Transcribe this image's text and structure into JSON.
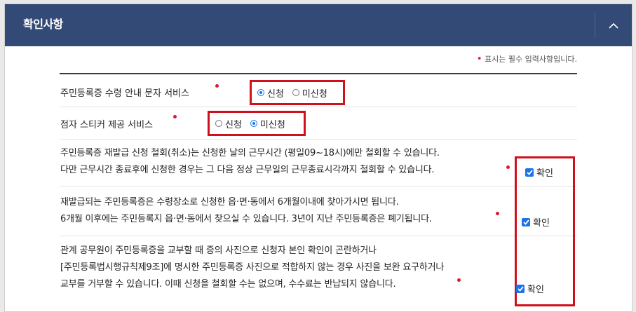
{
  "header": {
    "title": "확인사항"
  },
  "required_note": "표시는 필수 입력사항입니다.",
  "services": [
    {
      "label": "주민등록증 수령 안내 문자 서비스",
      "options": [
        "신청",
        "미신청"
      ],
      "selected": "신청"
    },
    {
      "label": "점자 스티커 제공 서비스",
      "options": [
        "신청",
        "미신청"
      ],
      "selected": "미신청"
    }
  ],
  "notices": [
    {
      "lines": [
        "주민등록증 재발급 신청 철회(취소)는 신청한 날의 근무시간 (평일09~18시)에만 철회할 수 있습니다.",
        "다만 근무시간 종료후에 신청한 경우는 그 다음 정상 근무일의 근무종료시각까지 철회할 수 있습니다."
      ],
      "confirm_label": "확인",
      "checked": true
    },
    {
      "lines": [
        "재발급되는 주민등록증은 수령장소로 신청한 읍·면·동에서 6개월이내에 찾아가시면 됩니다.",
        "6개월 이후에는 주민등록지 읍·면·동에서 찾으실 수 있습니다. 3년이 지난 주민등록증은 폐기됩니다."
      ],
      "confirm_label": "확인",
      "checked": true
    },
    {
      "lines": [
        "관계 공무원이 주민등록증을 교부할 때 증의 사진으로 신청자 본인 확인이 곤란하거나",
        "[주민등록법시행규칙제9조]에 명시한 주민등록증 사진으로 적합하지 않는 경우 사진을 보완 요구하거나",
        "교부를 거부할 수 있습니다. 이때 신청을 철회할 수는 없으며, 수수료는 반납되지 않습니다."
      ],
      "confirm_label": "확인",
      "checked": true
    }
  ],
  "colors": {
    "header_bg": "#324a75",
    "highlight": "#d0101c",
    "required": "#e0182c",
    "accent": "#1a73e8"
  }
}
